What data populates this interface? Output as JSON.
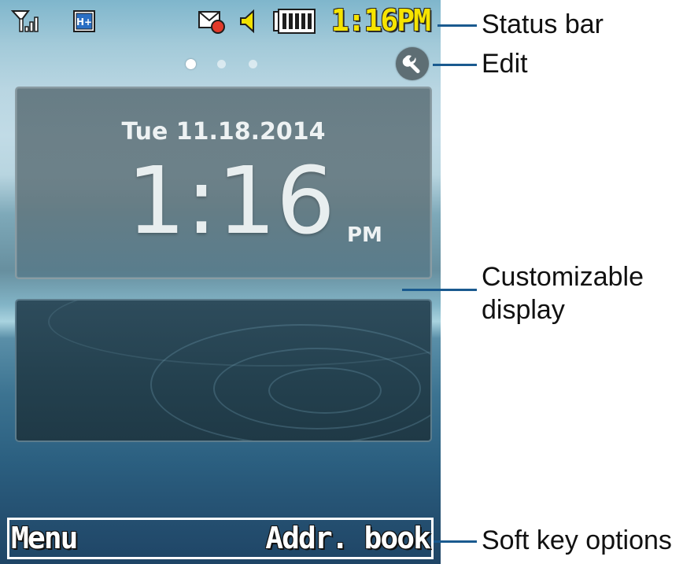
{
  "status_bar": {
    "icons": [
      "signal-strength-icon",
      "hsdpa-network-icon",
      "message-icon",
      "volume-icon",
      "battery-icon"
    ],
    "time": "1:16PM",
    "time_color": "#f6e400"
  },
  "home_screen": {
    "page_indicator": {
      "pages": 3,
      "current": 1
    },
    "clock_widget": {
      "date": "Tue 11.18.2014",
      "time": "1:16",
      "ampm": "PM"
    }
  },
  "soft_keys": {
    "left": "Menu",
    "right": "Addr. book"
  },
  "callouts": {
    "status_bar": "Status bar",
    "edit": "Edit",
    "customizable_display_line1": "Customizable",
    "customizable_display_line2": "display",
    "soft_key_options": "Soft key options",
    "line_color": "#1a5a8f"
  }
}
